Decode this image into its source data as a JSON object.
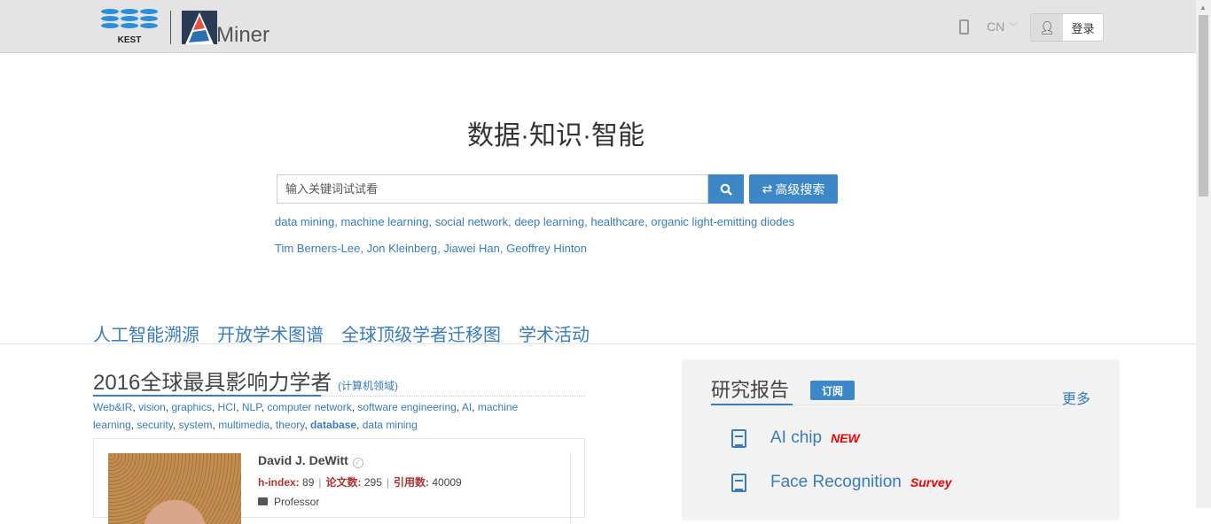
{
  "header": {
    "logo_k_text": "KEST",
    "logo_brand": "Miner",
    "lang": "CN",
    "login_label": "登录"
  },
  "hero": {
    "slogan": "数据·知识·智能",
    "search_placeholder": "输入关键词试试看",
    "advanced_label": "高级搜索",
    "hot_topics": [
      "data mining",
      "machine learning",
      "social network",
      "deep learning",
      "healthcare",
      "organic light-emitting diodes"
    ],
    "hot_people": [
      "Tim Berners-Lee",
      "Jon Kleinberg",
      "Jiawei Han",
      "Geoffrey Hinton"
    ]
  },
  "nav": [
    "人工智能溯源",
    "开放学术图谱",
    "全球顶级学者迁移图",
    "学术活动"
  ],
  "scholars": {
    "title": "2016全球最具影响力学者",
    "subtitle": "(计算机领域)",
    "topics": [
      "Web&IR",
      "vision",
      "graphics",
      "HCI",
      "NLP",
      "computer network",
      "software engineering",
      "AI",
      "machine learning",
      "security",
      "system",
      "multimedia",
      "theory",
      "database",
      "data mining"
    ],
    "active_topic": "database",
    "card": {
      "name": "David J. DeWitt",
      "hindex_label": "h-index:",
      "hindex": "89",
      "papers_label": "论文数:",
      "papers": "295",
      "cites_label": "引用数:",
      "cites": "40009",
      "position": "Professor"
    }
  },
  "reports": {
    "title": "研究报告",
    "subscribe": "订阅",
    "more": "更多",
    "items": [
      {
        "title": "AI chip",
        "tag": "NEW"
      },
      {
        "title": "Face Recognition",
        "tag": "Survey"
      }
    ]
  },
  "colors": {
    "accent": "#3d87c9",
    "link": "#3a7bb8",
    "tag": "#e00000"
  }
}
